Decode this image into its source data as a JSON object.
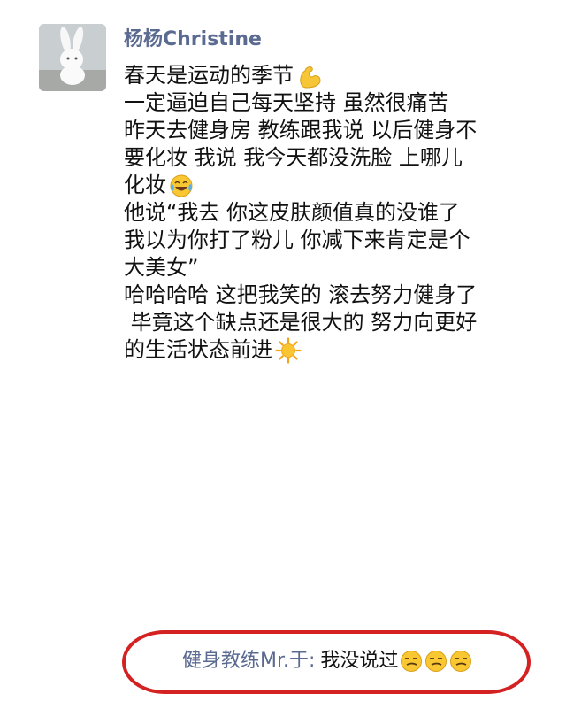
{
  "post": {
    "username": "杨杨Christine",
    "avatar_icon": "white-bunny-icon",
    "lines": [
      "春天是运动的季节",
      "一定逼迫自己每天坚持 虽然很痛苦",
      "昨天去健身房 教练跟我说 以后健身不",
      "要化妆 我说 我今天都没洗脸 上哪儿",
      "化妆",
      "他说“我去 你这皮肤颜值真的没谁了",
      "我以为你打了粉儿 你减下来肯定是个",
      "大美女”",
      "哈哈哈哈 这把我笑的 滚去努力健身了",
      " 毕竟这个缺点还是很大的 努力向更好",
      "的生活状态前进"
    ],
    "emojis": {
      "line0": "flexed-biceps-emoji",
      "line4": "tears-of-joy-emoji",
      "line10": "sun-emoji"
    }
  },
  "comment": {
    "author": "健身教练Mr.于:",
    "text": "我没说过",
    "emoji": "smirk-emoji",
    "emoji_count": 3,
    "highlight_color": "#d42222"
  },
  "colors": {
    "name_color": "#5b6a91",
    "text_color": "#111111"
  }
}
